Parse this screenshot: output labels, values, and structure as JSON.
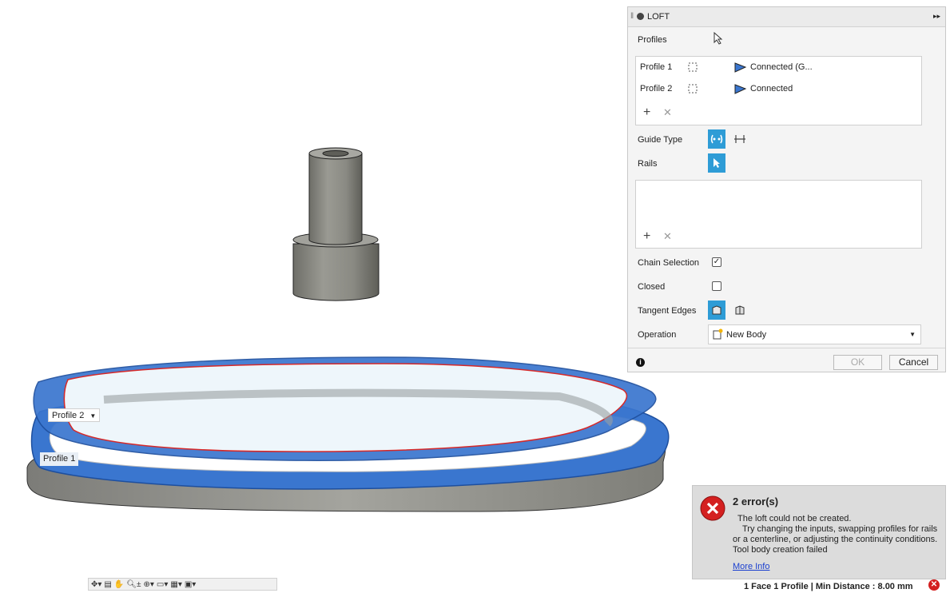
{
  "loft_panel": {
    "title": "LOFT",
    "profiles_label": "Profiles",
    "profiles": [
      {
        "name": "Profile 1",
        "status": "Connected (G..."
      },
      {
        "name": "Profile 2",
        "status": "Connected"
      }
    ],
    "guide_type_label": "Guide Type",
    "rails_label": "Rails",
    "chain_selection_label": "Chain Selection",
    "chain_selection_checked": true,
    "closed_label": "Closed",
    "closed_checked": false,
    "tangent_edges_label": "Tangent Edges",
    "operation_label": "Operation",
    "operation_value": "New Body",
    "ok_label": "OK",
    "cancel_label": "Cancel"
  },
  "viewport": {
    "profile2_tag": "Profile 2",
    "profile1_tag": "Profile 1"
  },
  "error": {
    "title": "2 error(s)",
    "line1": "The loft could not be created.",
    "line2": "Try changing the inputs, swapping profiles for rails",
    "line3": "or a centerline, or adjusting the continuity conditions.",
    "line4": "Tool body creation failed",
    "more_info": "More Info"
  },
  "status_bar": {
    "text": "1 Face 1 Profile | Min Distance : 8.00 mm"
  },
  "colors": {
    "accent_blue": "#2e9cd6",
    "selection_blue": "#3a76cf",
    "error_red": "#d42020"
  },
  "icons": [
    "select-arrow-icon",
    "profile-point-icon",
    "continuity-icon",
    "add-icon",
    "remove-icon",
    "guide-rail-icon",
    "guide-centerline-icon",
    "cursor-icon",
    "tangent-merge-icon",
    "tangent-keep-icon",
    "new-body-icon",
    "info-icon",
    "error-icon",
    "orbit-icon",
    "look-at-icon",
    "pan-icon",
    "zoom-icon",
    "fit-icon",
    "display-icon",
    "grid-icon",
    "viewports-icon"
  ]
}
